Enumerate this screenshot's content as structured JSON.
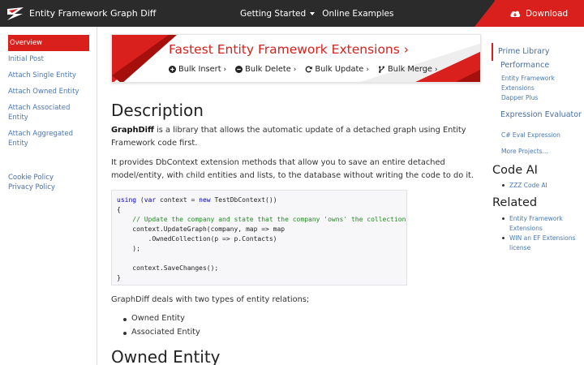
{
  "topnav": {
    "brand": "Entity Framework Graph Diff",
    "links": [
      "Getting Started",
      "Online Examples"
    ],
    "download": "Download",
    "colors": {
      "bar": "#2b2b2b",
      "accent": "#d9201c"
    }
  },
  "leftbar": {
    "items": [
      "Overview",
      "Initial Post",
      "Attach Single Entity",
      "Attach Owned Entity",
      "Attach Associated Entity",
      "Attach Aggregated Entity"
    ],
    "footer": [
      "Cookie Policy",
      "Privacy Policy"
    ]
  },
  "banner": {
    "title": "Fastest Entity Framework Extensions",
    "title_chevron": "›",
    "links": [
      {
        "icon": "plus-circle-icon",
        "label": "Bulk Insert"
      },
      {
        "icon": "minus-circle-icon",
        "label": "Bulk Delete"
      },
      {
        "icon": "refresh-icon",
        "label": "Bulk Update"
      },
      {
        "icon": "merge-icon",
        "label": "Bulk Merge"
      }
    ]
  },
  "main": {
    "description_heading": "Description",
    "para1_bold": "GraphDiff",
    "para1_rest": " is a library that allows the automatic update of a detached graph using Entity Framework code first.",
    "para2": "It provides DbContext extension methods that allow you to save an entire detached model/entity, with child entities and lists, to the database without writing the code to do it.",
    "code": {
      "line1_kw1": "using",
      "line1_a": " (",
      "line1_kw2": "var",
      "line1_b": " context = ",
      "line1_kw3": "new",
      "line1_c": " TestDbContext())",
      "line2": "{",
      "line3": "    // Update the company and state that the company 'owns' the collection",
      "line4": "    context.UpdateGraph(company, map => map",
      "line5": "        .OwnedCollection(p => p.Contacts)",
      "line6": "    );",
      "line7": "",
      "line8": "    context.SaveChanges();",
      "line9": "}"
    },
    "para3": "GraphDiff deals with two types of entity relations;",
    "bullets": [
      "Owned Entity",
      "Associated Entity"
    ],
    "owned_heading": "Owned Entity"
  },
  "rightbar": {
    "prime": "Prime Library",
    "performance": "Performance",
    "perf_items": [
      "Entity Framework Extensions",
      "Dapper Plus"
    ],
    "expression": "Expression Evaluator",
    "expr_items": [
      "C# Eval Expression"
    ],
    "more": "More Projects...",
    "code_ai": "Code AI",
    "code_ai_items": [
      "ZZZ Code AI"
    ],
    "related": "Related",
    "related_items": [
      "Entity Framework Extensions",
      "WIN an EF Extensions license"
    ]
  }
}
